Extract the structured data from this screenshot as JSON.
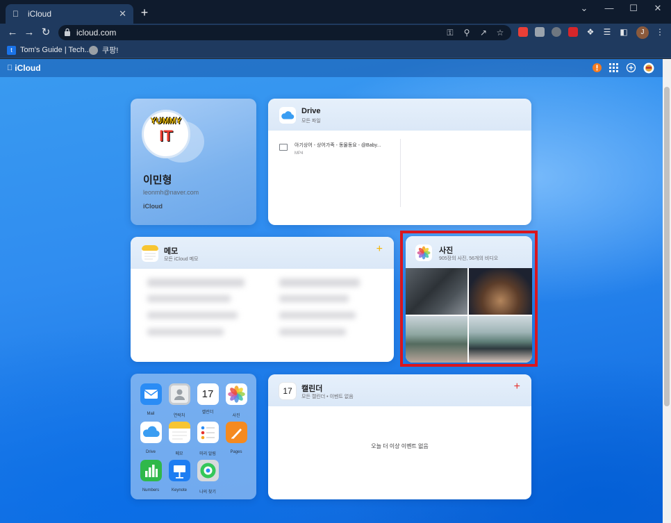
{
  "browser": {
    "tab_title": "iCloud",
    "tab_close": "✕",
    "new_tab": "+",
    "window_controls": [
      "⌄",
      "—",
      "☐",
      "✕"
    ],
    "url": "icloud.com",
    "bookmarks": [
      {
        "label": "Tom's Guide | Tech...",
        "icon": "t"
      },
      {
        "label": "쿠팡!",
        "icon": "globe"
      }
    ],
    "profile_initial": "J"
  },
  "icloud": {
    "brand": "iCloud",
    "profile": {
      "name": "이민형",
      "email": "leonmh@naver.com",
      "service": "iCloud",
      "memoji_text_1": "YUMMY",
      "memoji_text_2": "IT"
    },
    "drive": {
      "title": "Drive",
      "subtitle": "모든 파일",
      "files": [
        {
          "name": "아기상어 - 상어가족 - 동물동요 - @Baby...",
          "type": "MP4"
        }
      ]
    },
    "notes": {
      "title": "메모",
      "subtitle": "모든 iCloud 메모",
      "add": "+"
    },
    "photos": {
      "title": "사진",
      "subtitle": "905장의 사진, 56개의 비디오"
    },
    "calendar": {
      "title": "캘린더",
      "subtitle": "모든 캘린더 • 이벤트 없음",
      "add": "+",
      "icon_day": "17",
      "empty": "오늘 더 이상 이벤트 없음"
    },
    "apps": [
      {
        "label": "Mail",
        "icon": "mail-icon"
      },
      {
        "label": "연락처",
        "icon": "contacts-icon"
      },
      {
        "label": "캘린더",
        "icon": "calendar-icon",
        "day": "17"
      },
      {
        "label": "사진",
        "icon": "photos-icon"
      },
      {
        "label": "Drive",
        "icon": "drive-icon"
      },
      {
        "label": "메모",
        "icon": "notes-icon"
      },
      {
        "label": "미리 알림",
        "icon": "reminders-icon"
      },
      {
        "label": "Pages",
        "icon": "pages-icon"
      },
      {
        "label": "Numbers",
        "icon": "numbers-icon"
      },
      {
        "label": "Keynote",
        "icon": "keynote-icon"
      },
      {
        "label": "나의 찾기",
        "icon": "find-my-icon"
      }
    ]
  },
  "colors": {
    "accent_yellow": "#f5b400",
    "calendar_red": "#e5322d",
    "highlight": "#d9161e"
  }
}
